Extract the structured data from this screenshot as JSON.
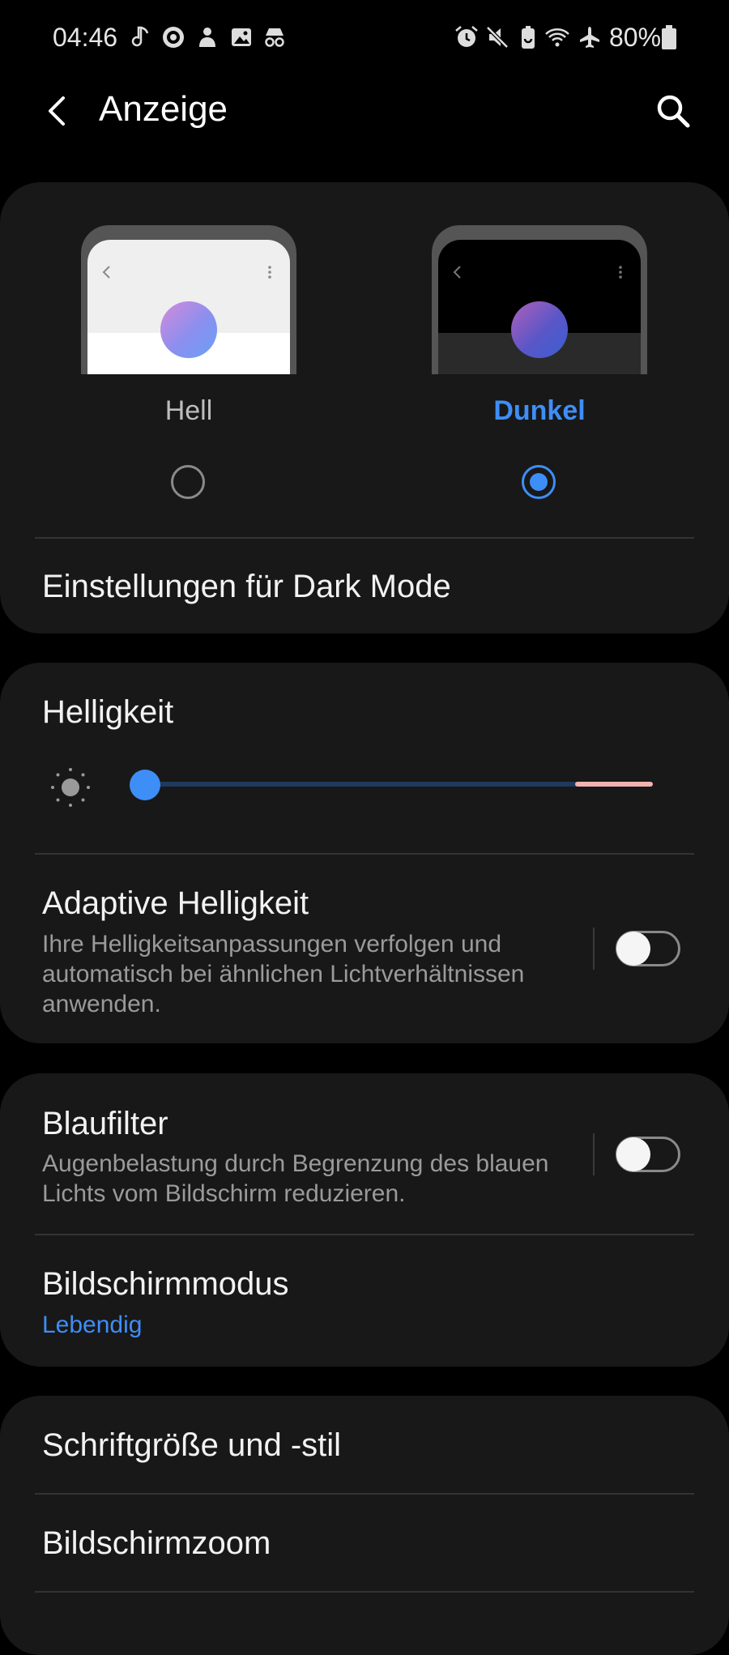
{
  "status_bar": {
    "time": "04:46",
    "battery": "80%",
    "left_icons": [
      "music-note-icon",
      "record-icon",
      "bell-person-icon",
      "gallery-icon",
      "incognito-icon"
    ],
    "right_icons": [
      "alarm-icon",
      "mute-icon",
      "battery-saver-icon",
      "wifi-icon",
      "airplane-icon",
      "battery-icon"
    ]
  },
  "header": {
    "title": "Anzeige"
  },
  "theme": {
    "light_label": "Hell",
    "dark_label": "Dunkel",
    "selected": "dark",
    "accent": "#3e8ef7"
  },
  "dark_mode_settings": {
    "label": "Einstellungen für Dark Mode"
  },
  "brightness": {
    "label": "Helligkeit",
    "level": 0.02
  },
  "adaptive_brightness": {
    "label": "Adaptive Helligkeit",
    "description": "Ihre Helligkeitsanpassungen verfolgen und automatisch bei ähnlichen Lichtverhältnissen anwenden.",
    "enabled": false
  },
  "blue_filter": {
    "label": "Blaufilter",
    "description": "Augenbelastung durch Begrenzung des blauen Lichts vom Bildschirm reduzieren.",
    "enabled": false
  },
  "screen_mode": {
    "label": "Bildschirmmodus",
    "value": "Lebendig"
  },
  "font_size": {
    "label": "Schriftgröße und -stil"
  },
  "screen_zoom": {
    "label": "Bildschirmzoom"
  }
}
